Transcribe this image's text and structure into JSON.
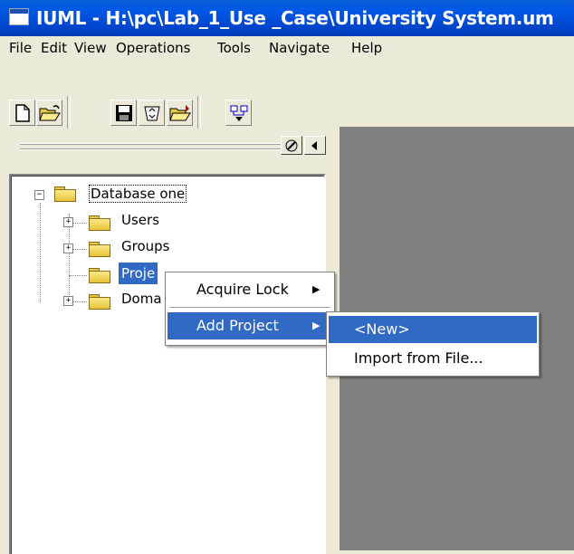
{
  "window": {
    "title": "IUML - H:\\pc\\Lab_1_Use _Case\\University System.um"
  },
  "menubar": {
    "items": [
      "File",
      "Edit",
      "View",
      "Operations",
      "Tools",
      "Navigate",
      "Help"
    ]
  },
  "toolbar": {
    "buttons": [
      "new-icon",
      "open-icon",
      "save-icon",
      "recycle-icon",
      "import-icon",
      "model-icon"
    ]
  },
  "tree": {
    "root": "Database one",
    "children": [
      "Users",
      "Groups",
      "Projects",
      "Domains"
    ],
    "visible_children": [
      "Users",
      "Groups",
      "Proje",
      "Doma"
    ]
  },
  "context_menu": {
    "items": [
      "Acquire Lock",
      "Add Project"
    ],
    "selected": "Add Project"
  },
  "submenu": {
    "items": [
      "<New>",
      "Import from File..."
    ],
    "selected": "<New>"
  },
  "colors": {
    "title_bar": "#0058e6",
    "selection": "#316ac5",
    "workspace": "#808080"
  }
}
